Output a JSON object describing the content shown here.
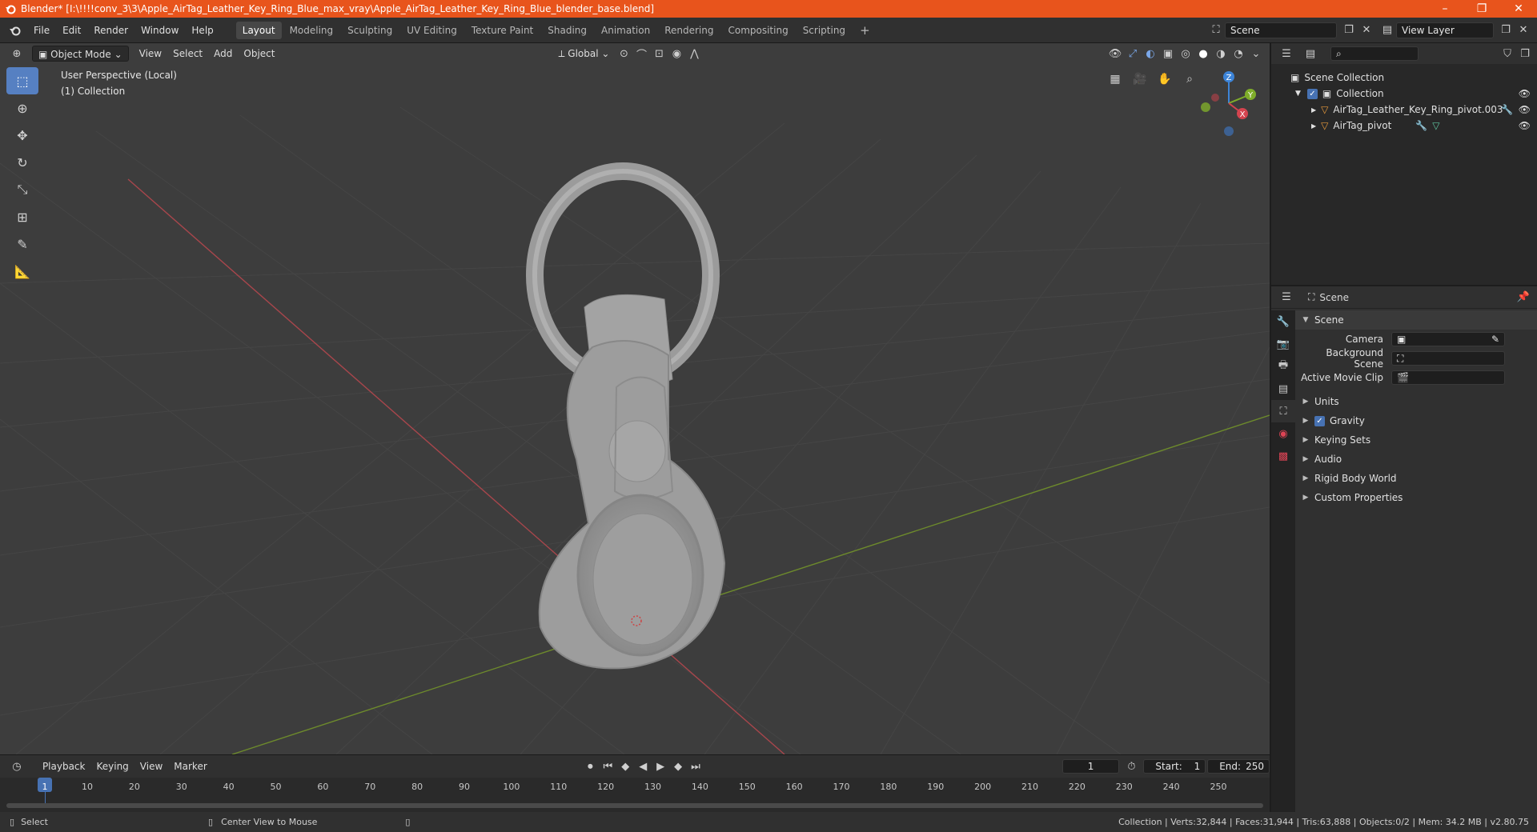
{
  "window": {
    "title": "Blender* [I:\\!!!!conv_3\\3\\Apple_AirTag_Leather_Key_Ring_Blue_max_vray\\Apple_AirTag_Leather_Key_Ring_Blue_blender_base.blend]",
    "minimize": "–",
    "maximize": "❐",
    "close": "✕"
  },
  "menu": [
    "File",
    "Edit",
    "Render",
    "Window",
    "Help"
  ],
  "workspaces": [
    "Layout",
    "Modeling",
    "Sculpting",
    "UV Editing",
    "Texture Paint",
    "Shading",
    "Animation",
    "Rendering",
    "Compositing",
    "Scripting"
  ],
  "active_workspace": "Layout",
  "add_workspace": "+",
  "scene_field": "Scene",
  "view_layer_field": "View Layer",
  "viewport": {
    "mode": "Object Mode",
    "menus": [
      "View",
      "Select",
      "Add",
      "Object"
    ],
    "orientation": "Global",
    "info_line1": "User Perspective (Local)",
    "info_line2": "(1) Collection",
    "gizmo": {
      "x": "X",
      "y": "Y",
      "z": "Z"
    }
  },
  "outliner": {
    "root": "Scene Collection",
    "collection": "Collection",
    "items": [
      "AirTag_Leather_Key_Ring_pivot.003",
      "AirTag_pivot"
    ]
  },
  "properties": {
    "header": "Scene",
    "panel": "Scene",
    "camera_label": "Camera",
    "background_scene_label": "Background Scene",
    "active_movie_clip_label": "Active Movie Clip",
    "sections": [
      "Units",
      "Gravity",
      "Keying Sets",
      "Audio",
      "Rigid Body World",
      "Custom Properties"
    ]
  },
  "timeline": {
    "menus": [
      "Playback",
      "Keying",
      "View",
      "Marker"
    ],
    "current_frame": "1",
    "start_label": "Start:",
    "start": "1",
    "end_label": "End:",
    "end": "250",
    "ticks": [
      "1",
      "10",
      "20",
      "30",
      "40",
      "50",
      "60",
      "70",
      "80",
      "90",
      "100",
      "110",
      "120",
      "130",
      "140",
      "150",
      "160",
      "170",
      "180",
      "190",
      "200",
      "210",
      "220",
      "230",
      "240",
      "250"
    ]
  },
  "status": {
    "select": "Select",
    "center_view": "Center View to Mouse",
    "stats": "Collection | Verts:32,844 | Faces:31,944 | Tris:63,888 | Objects:0/2 | Mem: 34.2 MB | v2.80.75"
  }
}
